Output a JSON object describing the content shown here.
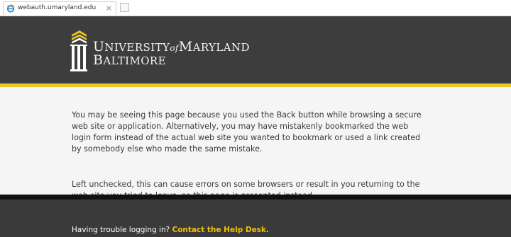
{
  "browser": {
    "tab_title": "webauth.umaryland.edu",
    "tab_close": "×",
    "favicon": "internet-explorer-icon"
  },
  "header": {
    "logo": {
      "line1_initial": "U",
      "line1_rest": "NIVERSITY",
      "line1_of": "of",
      "line1_initial2": "M",
      "line1_rest2": "ARYLAND",
      "line2_initial": "B",
      "line2_rest": "ALTIMORE"
    },
    "colors": {
      "background": "#3d3d3d",
      "accent": "#e8c52a"
    }
  },
  "main": {
    "paragraph1": "You may be seeing this page because you used the Back button while browsing a secure web site or application. Alternatively, you may have mistakenly bookmarked the web login form instead of the actual web site you wanted to bookmark or used a link created by somebody else who made the same mistake.",
    "paragraph2": "Left unchecked, this can cause errors on some browsers or result in you returning to the web site you tried to leave, so this page is presented instead."
  },
  "footer": {
    "prompt": "Having trouble logging in?",
    "link_label": "Contact the Help Desk.",
    "link_color": "#f2c200"
  }
}
